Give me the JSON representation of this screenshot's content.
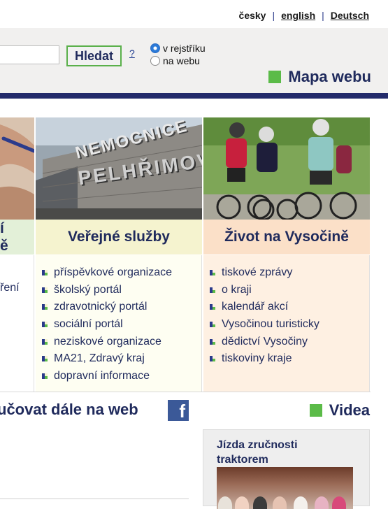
{
  "language_links": [
    {
      "label": "česky",
      "active": true
    },
    {
      "label": "english",
      "active": false
    },
    {
      "label": "Deutsch",
      "active": false
    }
  ],
  "language_separator": "|",
  "search": {
    "value": "",
    "button_label": "Hledat",
    "help_label": "?",
    "scope_options": [
      {
        "label": "v rejstříku",
        "selected": true
      },
      {
        "label": "na webu",
        "selected": false
      }
    ]
  },
  "sitemap": {
    "label": "Mapa webu",
    "icon": "green-square-icon"
  },
  "columns": [
    {
      "title_fragment": [
        "í",
        "ě"
      ],
      "links": [
        "ření"
      ]
    },
    {
      "title": "Veřejné služby",
      "links": [
        "příspěvkové organizace",
        "školský portál",
        "zdravotnický portál",
        "sociální portál",
        "neziskové organizace",
        "MA21, Zdravý kraj",
        "dopravní informace"
      ]
    },
    {
      "title": "Život na Vysočině",
      "links": [
        "tiskové zprávy",
        "o kraji",
        "kalendář akcí",
        "Vysočinou turisticky",
        "dědictví Vysočiny",
        "tiskoviny kraje"
      ]
    }
  ],
  "photo_text": {
    "line1": "NEMOCNICE",
    "line2": "PELHŘIMOV"
  },
  "social": {
    "text": "učovat dále na web",
    "icon": "facebook-icon"
  },
  "videos": {
    "heading": "Videa",
    "item_title": "Jízda zručnosti traktorem"
  },
  "colors": {
    "navy": "#1f2a5c",
    "green": "#5bbb48",
    "facebook": "#3b5998",
    "col_public": "#f5f3cf",
    "col_life": "#fbe0c8"
  }
}
